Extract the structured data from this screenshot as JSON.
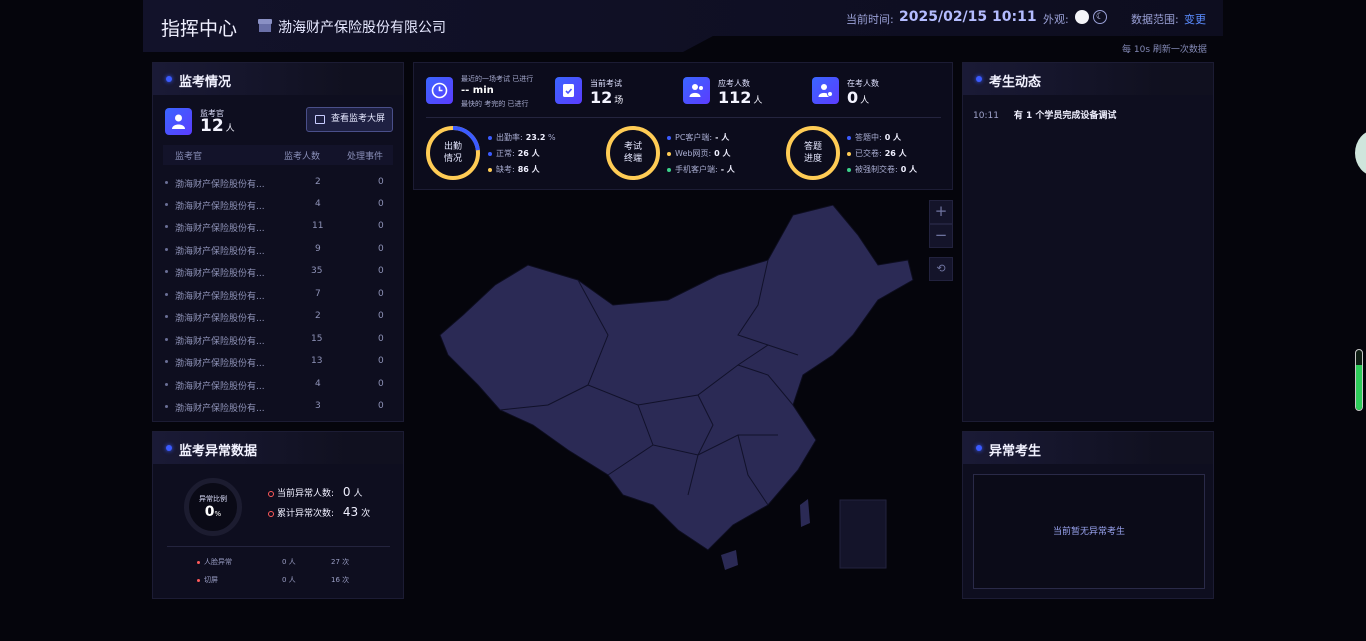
{
  "header": {
    "title": "指挥中心",
    "company": "渤海财产保险股份有限公司",
    "time_label": "当前时间:",
    "time_value": "2025/02/15 10:11",
    "appearance_label": "外观:",
    "data_range_label": "数据范围:",
    "data_range_link": "变更",
    "refresh_note": "每 10s 刷新一次数据"
  },
  "monitor": {
    "title": "监考情况",
    "invigilator_label": "监考官",
    "invigilator_count": "12",
    "invigilator_unit": "人",
    "screen_button": "查看监考大屏",
    "columns": [
      "监考官",
      "监考人数",
      "处理事件"
    ],
    "rows": [
      {
        "name": "渤海财产保险股份有...",
        "count": "2",
        "events": "0"
      },
      {
        "name": "渤海财产保险股份有...",
        "count": "4",
        "events": "0"
      },
      {
        "name": "渤海财产保险股份有...",
        "count": "11",
        "events": "0"
      },
      {
        "name": "渤海财产保险股份有...",
        "count": "9",
        "events": "0"
      },
      {
        "name": "渤海财产保险股份有...",
        "count": "35",
        "events": "0"
      },
      {
        "name": "渤海财产保险股份有...",
        "count": "7",
        "events": "0"
      },
      {
        "name": "渤海财产保险股份有...",
        "count": "2",
        "events": "0"
      },
      {
        "name": "渤海财产保险股份有...",
        "count": "15",
        "events": "0"
      },
      {
        "name": "渤海财产保险股份有...",
        "count": "13",
        "events": "0"
      },
      {
        "name": "渤海财产保险股份有...",
        "count": "4",
        "events": "0"
      },
      {
        "name": "渤海财产保险股份有...",
        "count": "3",
        "events": "0"
      }
    ]
  },
  "abnormal": {
    "title": "监考异常数据",
    "ratio_label": "异常比例",
    "ratio_value": "0",
    "ratio_unit": "%",
    "current_label": "当前异常人数:",
    "current_value": "0",
    "current_unit": "人",
    "total_label": "累计异常次数:",
    "total_value": "43",
    "total_unit": "次",
    "types": [
      {
        "name": "人脸异常",
        "people": "0 人",
        "times": "27 次"
      },
      {
        "name": "切屏",
        "people": "0 人",
        "times": "16 次"
      }
    ],
    "accent": "#ff5a5a"
  },
  "stats": {
    "first_line": "最近的一场考试 已进行",
    "first_value": "-- min",
    "first_sub": "最快的 考完的 已进行",
    "current_exam_label": "当前考试",
    "current_exam_value": "12",
    "current_exam_unit": "场",
    "expected_label": "应考人数",
    "expected_value": "112",
    "expected_unit": "人",
    "online_label": "在考人数",
    "online_value": "0",
    "online_unit": "人",
    "attendance": {
      "label1": "出勤",
      "label2": "情况",
      "rate_label": "出勤率:",
      "rate_value": "23.2",
      "rate_unit": "%",
      "normal_label": "正常:",
      "normal_value": "26 人",
      "absent_label": "缺考:",
      "absent_value": "86 人",
      "rate_fraction": 0.232
    },
    "terminal": {
      "label1": "考试",
      "label2": "终端",
      "pc_label": "PC客户端:",
      "pc_value": "- 人",
      "web_label": "Web网页:",
      "web_value": "0 人",
      "mobile_label": "手机客户端:",
      "mobile_value": "- 人"
    },
    "progress": {
      "label1": "答题",
      "label2": "进度",
      "answering_label": "答题中:",
      "answering_value": "0 人",
      "submitted_label": "已交卷:",
      "submitted_value": "26 人",
      "forced_label": "被强制交卷:",
      "forced_value": "0 人"
    }
  },
  "map_controls": {
    "zoom_in": "+",
    "zoom_out": "−",
    "reset": "⟲"
  },
  "events": {
    "title": "考生动态",
    "items": [
      {
        "time": "10:11",
        "message": "有 1 个学员完成设备调试"
      }
    ]
  },
  "abnormal_students": {
    "title": "异常考生",
    "empty_text": "当前暂无异常考生"
  }
}
